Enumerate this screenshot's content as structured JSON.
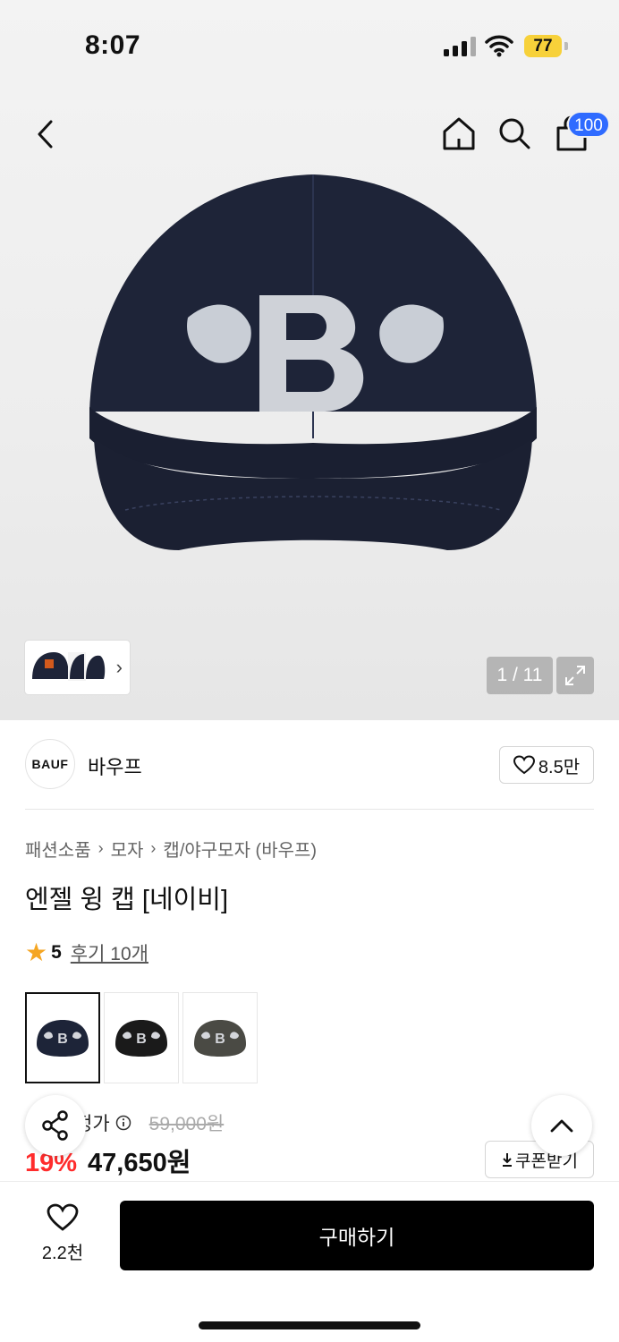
{
  "status_bar": {
    "time": "8:07",
    "battery": "77"
  },
  "nav": {
    "cart_count": "100"
  },
  "gallery": {
    "counter": "1 / 11"
  },
  "brand": {
    "logo_text": "BAUF",
    "name": "바우프",
    "likes": "8.5만"
  },
  "breadcrumb": [
    "패션소품",
    "모자",
    "캡/야구모자 (바우프)"
  ],
  "product": {
    "title": "엔젤 윙 캡 [네이비]",
    "rating": "5",
    "reviews": "후기 10개"
  },
  "swatches": [
    {
      "color": "#1d2438",
      "selected": true
    },
    {
      "color": "#1a1a1a",
      "selected": false
    },
    {
      "color": "#4a4a44",
      "selected": false
    }
  ],
  "price": {
    "label": "정가",
    "original": "59,000원",
    "discount": "19%",
    "final": "47,650원",
    "coupon": "쿠폰받기"
  },
  "bottom": {
    "wish_count": "2.2천",
    "buy_label": "구매하기"
  },
  "colors": {
    "accent_blue": "#2f6bff",
    "discount_red": "#ff2c2c",
    "star": "#f5a623",
    "battery": "#f7d13a"
  }
}
